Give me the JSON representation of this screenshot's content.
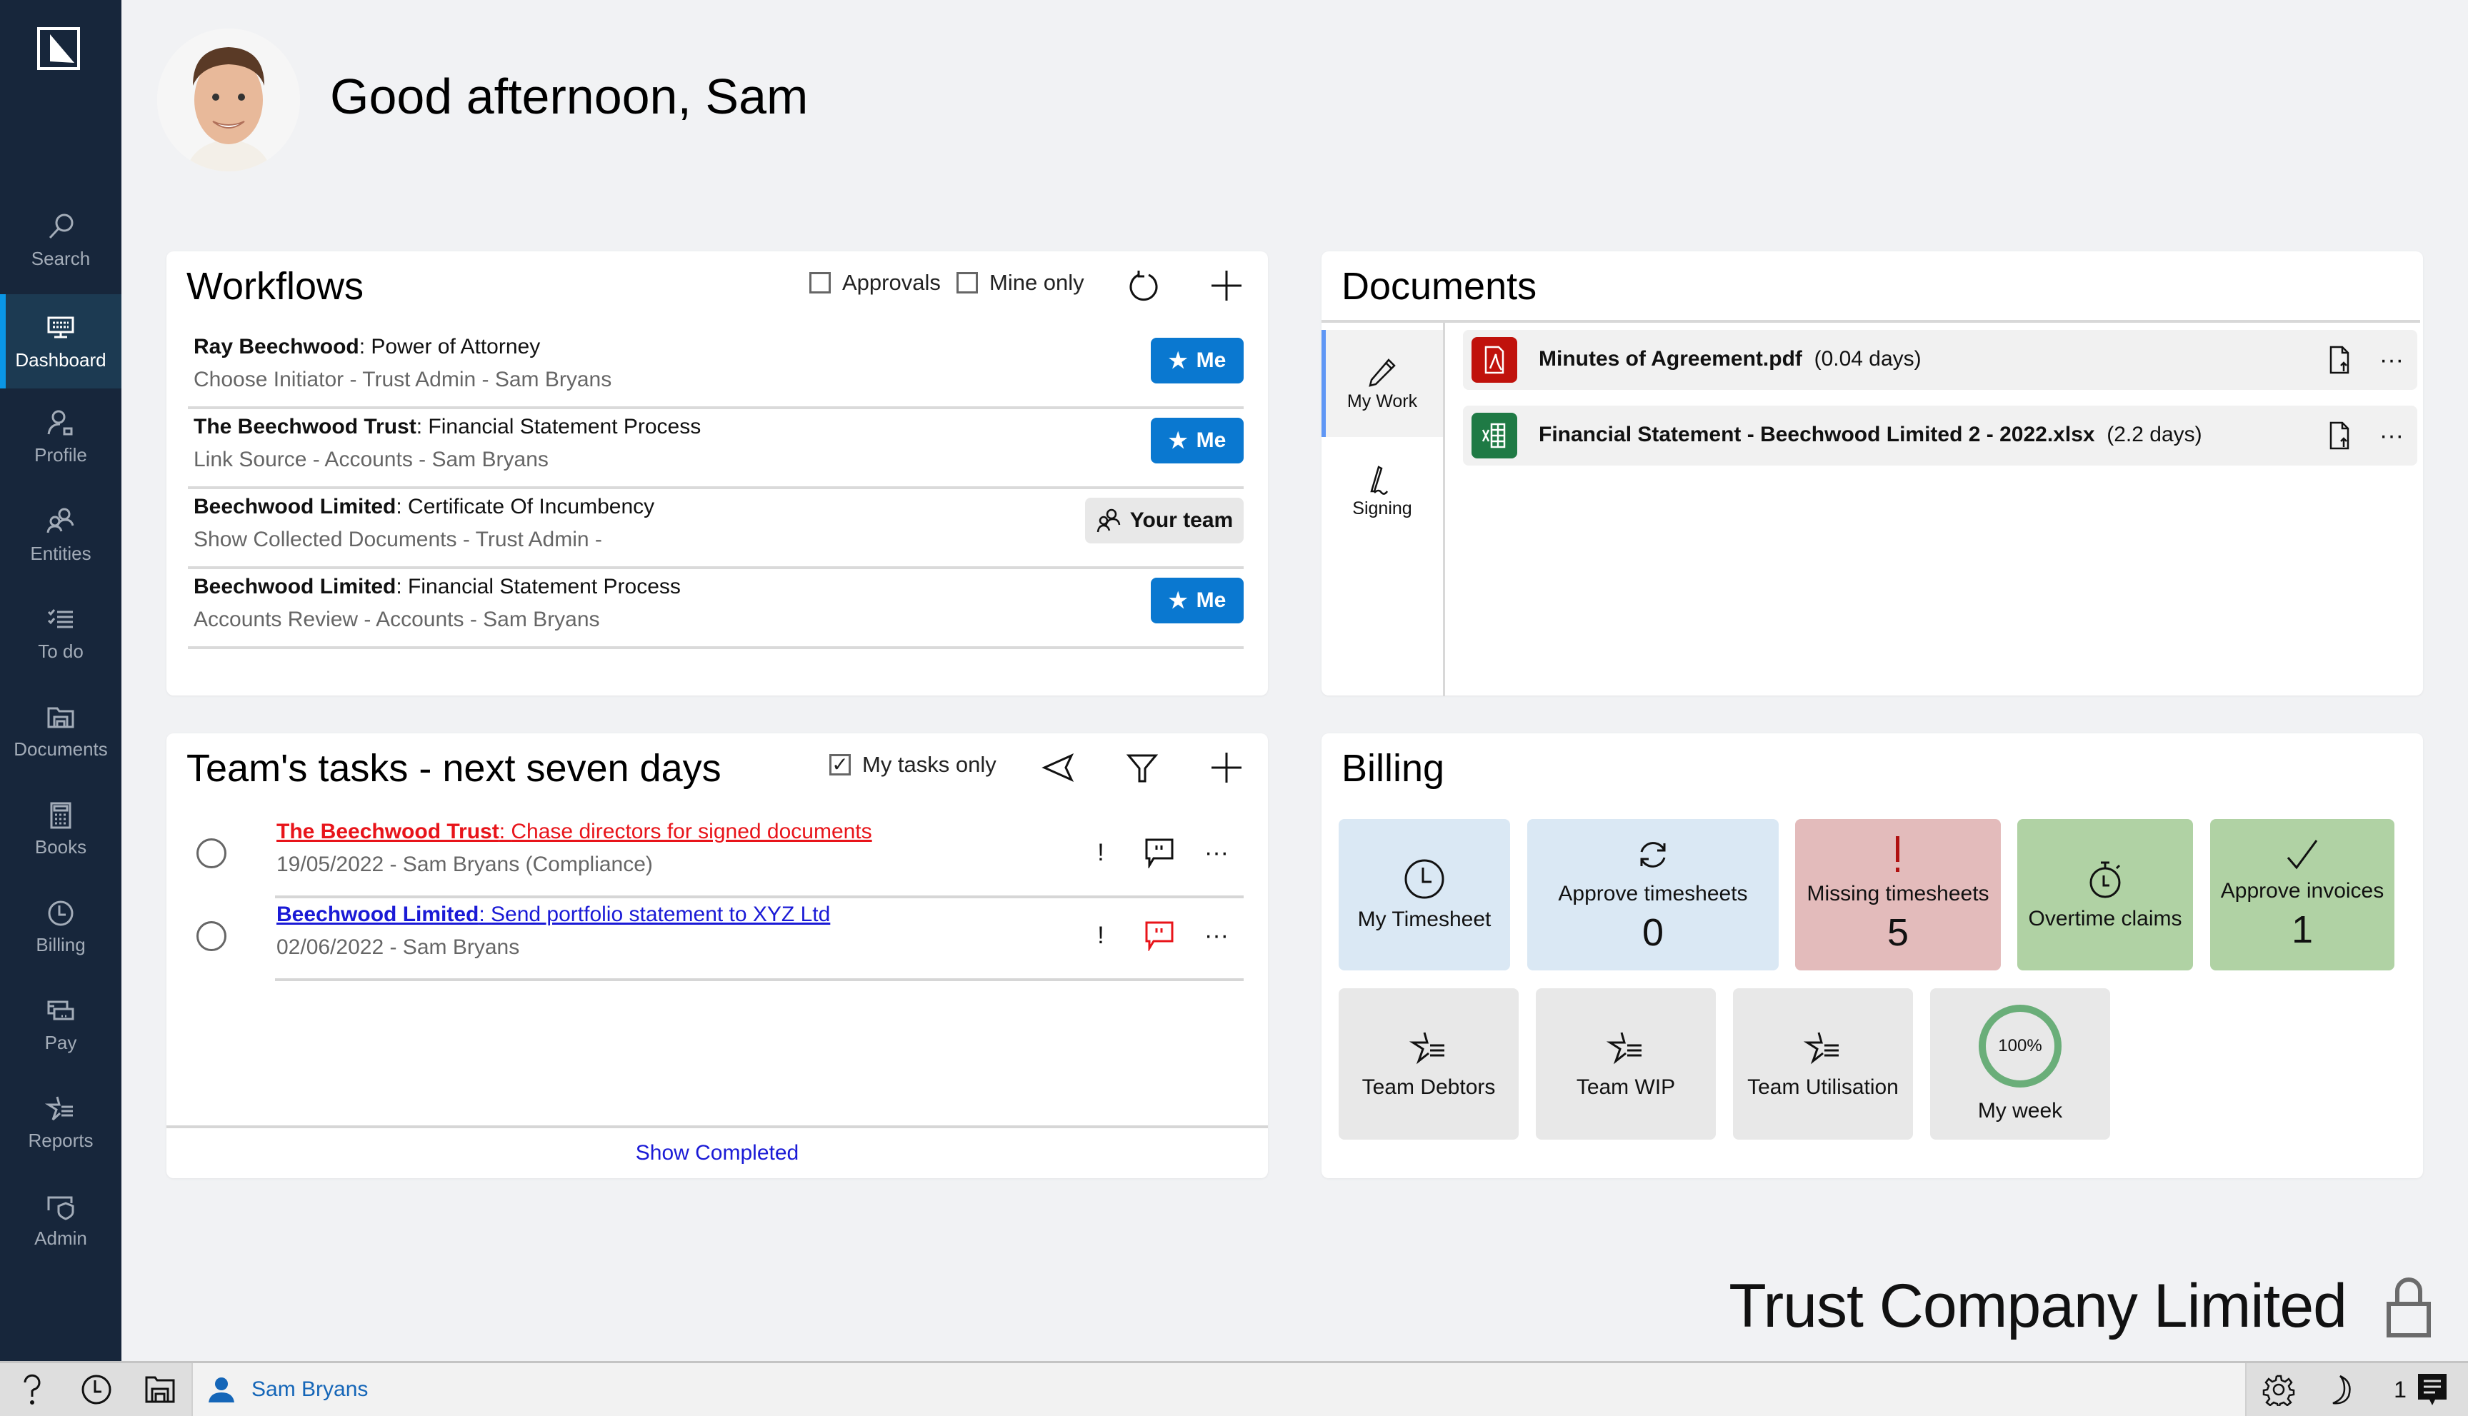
{
  "sidebar": {
    "items": [
      {
        "label": "Search",
        "icon": "search-icon",
        "active": false
      },
      {
        "label": "Dashboard",
        "icon": "dashboard-icon",
        "active": true
      },
      {
        "label": "Profile",
        "icon": "profile-icon",
        "active": false
      },
      {
        "label": "Entities",
        "icon": "entities-icon",
        "active": false
      },
      {
        "label": "To do",
        "icon": "todo-icon",
        "active": false
      },
      {
        "label": "Documents",
        "icon": "documents-icon",
        "active": false
      },
      {
        "label": "Books",
        "icon": "books-icon",
        "active": false
      },
      {
        "label": "Billing",
        "icon": "clock-icon",
        "active": false
      },
      {
        "label": "Pay",
        "icon": "pay-icon",
        "active": false
      },
      {
        "label": "Reports",
        "icon": "reports-icon",
        "active": false
      },
      {
        "label": "Admin",
        "icon": "admin-icon",
        "active": false
      }
    ]
  },
  "header": {
    "greeting": "Good afternoon, Sam"
  },
  "workflows": {
    "title": "Workflows",
    "approvals_label": "Approvals",
    "approvals_checked": false,
    "mine_only_label": "Mine only",
    "mine_only_checked": false,
    "items": [
      {
        "entity": "Ray Beechwood",
        "process": "Power of Attorney",
        "sub": "Choose Initiator - Trust Admin - Sam Bryans",
        "assignee": "Me"
      },
      {
        "entity": "The Beechwood Trust",
        "process": "Financial Statement Process",
        "sub": "Link Source - Accounts - Sam Bryans",
        "assignee": "Me"
      },
      {
        "entity": "Beechwood Limited",
        "process": "Certificate Of Incumbency",
        "sub": "Show Collected Documents - Trust Admin -",
        "assignee": "Your team"
      },
      {
        "entity": "Beechwood Limited",
        "process": "Financial Statement Process",
        "sub": "Accounts Review - Accounts - Sam Bryans",
        "assignee": "Me"
      }
    ]
  },
  "documents": {
    "title": "Documents",
    "tabs": [
      {
        "label": "My Work",
        "active": true
      },
      {
        "label": "Signing",
        "active": false
      }
    ],
    "items": [
      {
        "name": "Minutes of Agreement.pdf",
        "age": "(0.04 days)",
        "type": "pdf",
        "color": "#c0120c"
      },
      {
        "name": "Financial Statement - Beechwood Limited 2 - 2022.xlsx",
        "age": "(2.2 days)",
        "type": "xlsx",
        "color": "#1f7a45"
      }
    ]
  },
  "tasks": {
    "title": "Team's tasks - next seven days",
    "my_tasks_only_label": "My tasks only",
    "my_tasks_only_checked": true,
    "items": [
      {
        "entity": "The Beechwood Trust",
        "task": "Chase directors for signed documents",
        "sub": "19/05/2022 - Sam Bryans (Compliance)",
        "color": "#e8141a",
        "comment_color": "#111111",
        "priority": "!"
      },
      {
        "entity": "Beechwood Limited",
        "task": "Send portfolio statement to XYZ Ltd",
        "sub": "02/06/2022 - Sam Bryans",
        "color": "#1a1ad6",
        "comment_color": "#e8141a",
        "priority": "!"
      }
    ],
    "show_completed": "Show Completed"
  },
  "billing": {
    "title": "Billing",
    "tiles_row1": [
      {
        "label": "My Timesheet",
        "value": "",
        "icon": "clock-icon",
        "bg": "#dae8f4"
      },
      {
        "label": "Approve timesheets",
        "value": "0",
        "icon": "sync-icon",
        "bg": "#dae8f4"
      },
      {
        "label": "Missing timesheets",
        "value": "5",
        "icon": "alert-icon",
        "bg": "#e3bbbb"
      },
      {
        "label": "Overtime claims",
        "value": "",
        "icon": "stopwatch-icon",
        "bg": "#b0d2a4"
      },
      {
        "label": "Approve invoices",
        "value": "1",
        "icon": "check-icon",
        "bg": "#b0d2a4"
      }
    ],
    "tiles_row2": [
      {
        "label": "Team Debtors",
        "icon": "reports-icon"
      },
      {
        "label": "Team WIP",
        "icon": "reports-icon"
      },
      {
        "label": "Team Utilisation",
        "icon": "reports-icon"
      },
      {
        "label": "My week",
        "icon": "progress-ring",
        "progress_percent": 100,
        "progress_label": "100%"
      }
    ]
  },
  "footer": {
    "company": "Trust Company Limited"
  },
  "statusbar": {
    "user": "Sam Bryans",
    "notification_count": "1"
  }
}
